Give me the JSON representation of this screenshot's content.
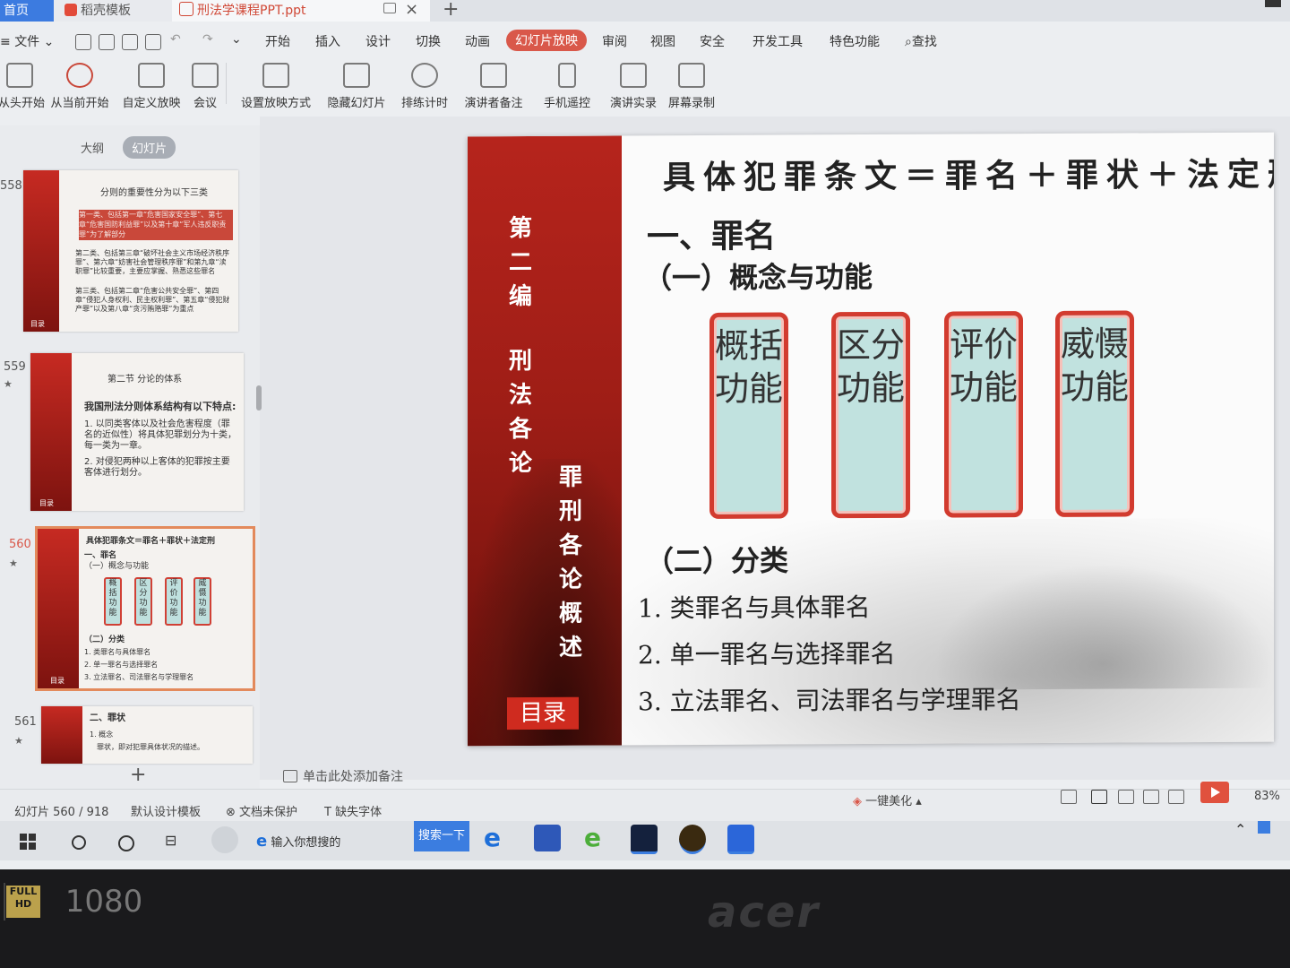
{
  "tabs": {
    "home": "首页",
    "template": "稻壳模板",
    "doc": "刑法学课程PPT.ppt"
  },
  "menu": {
    "file": "文件",
    "items": [
      "开始",
      "插入",
      "设计",
      "切换",
      "动画",
      "幻灯片放映",
      "审阅",
      "视图",
      "安全",
      "开发工具",
      "特色功能"
    ],
    "search": "查找"
  },
  "ribbon": [
    "从头开始",
    "从当前开始",
    "自定义放映",
    "会议",
    "设置放映方式",
    "隐藏幻灯片",
    "排练计时",
    "演讲者备注",
    "手机遥控",
    "演讲实录",
    "屏幕录制"
  ],
  "panel": {
    "tab_outline": "大纲",
    "tab_slides": "幻灯片",
    "thumbs": [
      {
        "num": "558",
        "caption": "分则的重要性分为以下三类",
        "lines": [
          "第一类、包括第一章“危害国家安全罪”、第七章“危害国防利益罪”以及第十章“军人违反职责罪”为了解部分",
          "第二类、包括第三章“破坏社会主义市场经济秩序罪”、第六章“妨害社会管理秩序罪”和第九章“渎职罪”比较重要，主要应掌握、熟悉这些罪名",
          "第三类、包括第二章“危害公共安全罪”、第四章“侵犯人身权利、民主权利罪”、第五章“侵犯财产罪”以及第八章“贪污贿赂罪”为重点"
        ],
        "footer": "目录"
      },
      {
        "num": "559",
        "title": "第二节 分论的体系",
        "intro": "我国刑法分则体系结构有以下特点:",
        "p1": "1. 以同类客体以及社会危害程度（罪名的近似性）将具体犯罪划分为十类，每一类为一章。",
        "p2": "2. 对侵犯两种以上客体的犯罪按主要客体进行划分。",
        "footer": "目录"
      },
      {
        "num": "560",
        "title": "具体犯罪条文＝罪名＋罪状＋法定刑",
        "h1": "一、罪名",
        "h2": "（一）概念与功能",
        "boxes": [
          "概括功能",
          "区分功能",
          "评价功能",
          "威慑功能"
        ],
        "h3": "（二）分类",
        "items": [
          "1. 类罪名与具体罪名",
          "2. 单一罪名与选择罪名",
          "3. 立法罪名、司法罪名与学理罪名"
        ],
        "footer": "目录"
      },
      {
        "num": "561",
        "h": "二、罪状",
        "l1": "1. 概念",
        "l2": "罪状，即对犯罪具体状况的描述。"
      }
    ]
  },
  "slide": {
    "side_col1": "第二编",
    "side_col2": "刑法各论",
    "side_col3": "罪刑各论概述",
    "side_footer": "目录",
    "title": "具体犯罪条文＝罪名＋罪状＋法定刑",
    "h1": "一、罪名",
    "h2": "（一）概念与功能",
    "boxes": [
      "概括功能",
      "区分功能",
      "评价功能",
      "威慑功能"
    ],
    "h3": "（二）分类",
    "items": [
      "1. 类罪名与具体罪名",
      "2. 单一罪名与选择罪名",
      "3. 立法罪名、司法罪名与学理罪名"
    ]
  },
  "notes_placeholder": "单击此处添加备注",
  "status": {
    "slide_counter": "幻灯片 560 / 918",
    "template": "默认设计模板",
    "protect": "文档未保护",
    "font": "缺失字体",
    "beautify": "一键美化",
    "zoom": "83%"
  },
  "taskbar": {
    "search_placeholder": "输入你想搜的",
    "search_button": "搜索一下"
  },
  "bezel": {
    "brand": "acer",
    "badge_top": "FULL HD",
    "badge_res": "1080"
  },
  "colors": {
    "accent": "#d9584a",
    "slide_red": "#b6241c",
    "box_fill": "#c1e2df",
    "box_border": "#d23b2f",
    "taskbar_blue": "#3b7de0"
  }
}
